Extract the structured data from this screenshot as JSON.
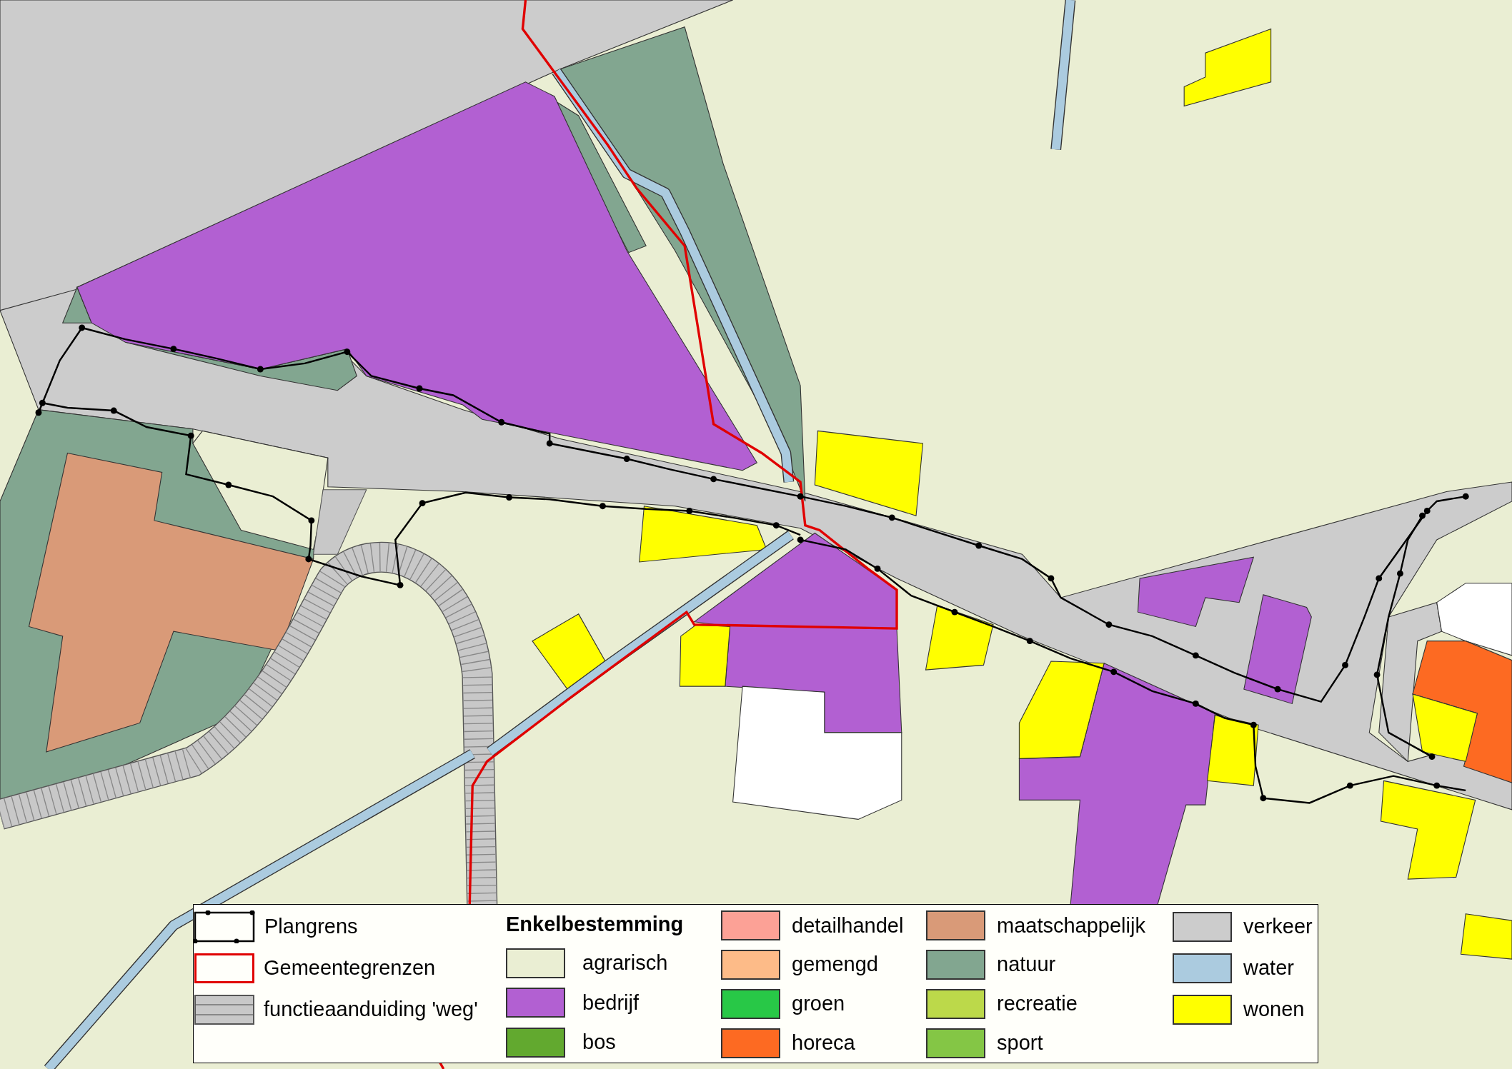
{
  "legend": {
    "items": [
      {
        "kind": "plangrens",
        "label": "Plangrens"
      },
      {
        "kind": "gemeentegrens",
        "label": "Gemeentegrenzen"
      },
      {
        "kind": "weg",
        "label": "functieaanduiding 'weg'"
      }
    ],
    "heading": "Enkelbestemming",
    "categories": [
      {
        "label": "agrarisch",
        "color": "#eaeed3"
      },
      {
        "label": "bedrijf",
        "color": "#b260d2"
      },
      {
        "label": "bos",
        "color": "#62a92f"
      },
      {
        "label": "detailhandel",
        "color": "#fca196"
      },
      {
        "label": "gemengd",
        "color": "#fdbb88"
      },
      {
        "label": "groen",
        "color": "#28c847"
      },
      {
        "label": "horeca",
        "color": "#fd6a22"
      },
      {
        "label": "maatschappelijk",
        "color": "#d99a78"
      },
      {
        "label": "natuur",
        "color": "#82a690"
      },
      {
        "label": "recreatie",
        "color": "#bcd94a"
      },
      {
        "label": "sport",
        "color": "#84c645"
      },
      {
        "label": "verkeer",
        "color": "#cccccc"
      },
      {
        "label": "water",
        "color": "#abcbdf"
      },
      {
        "label": "wonen",
        "color": "#ffff00"
      }
    ]
  }
}
